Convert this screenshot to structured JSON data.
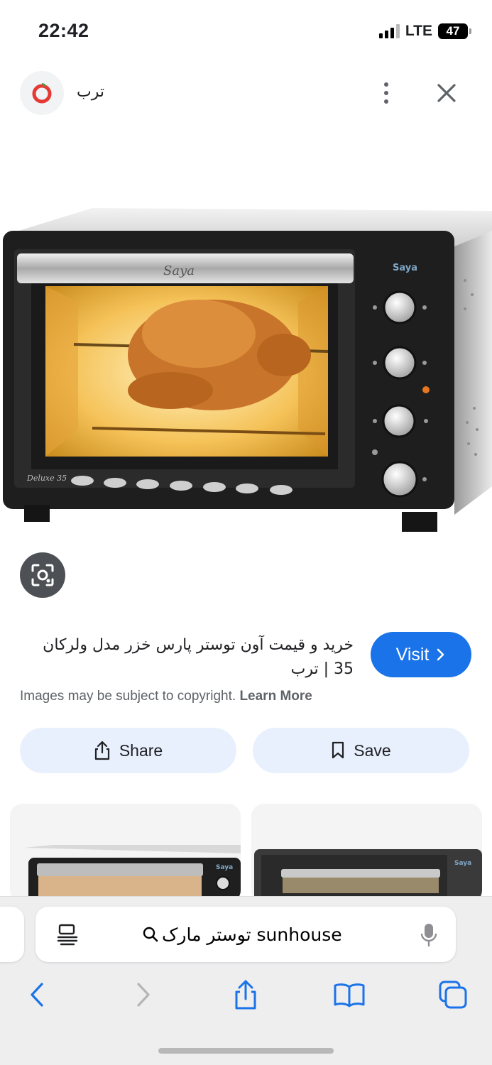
{
  "status_bar": {
    "time": "22:42",
    "network": "LTE",
    "battery": "47"
  },
  "top_bar": {
    "site_name": "ترب",
    "logo_icon": "torob-logo-icon",
    "menu_icon": "more-vertical-icon",
    "close_icon": "close-icon"
  },
  "result": {
    "title": "خرید و قیمت آون توستر پارس خزر مدل ولرکان 35 | ترب",
    "visit_label": "Visit",
    "copyright_text": "Images may be subject to copyright.",
    "learn_more": "Learn More",
    "share_label": "Share",
    "save_label": "Save"
  },
  "oven": {
    "brand": "Saya",
    "model": "Deluxe 35"
  },
  "related_thumbs": [
    {
      "brand": "Saya"
    },
    {
      "brand": "Saya"
    }
  ],
  "browser": {
    "search_query": "توستر مارک sunhouse",
    "reader_icon": "reader-icon",
    "mic_icon": "mic-icon"
  },
  "colors": {
    "accent_blue": "#1a73e8",
    "chip_bg": "#e8f0fe",
    "logo_red": "#e53935",
    "logo_green": "#43a047"
  }
}
